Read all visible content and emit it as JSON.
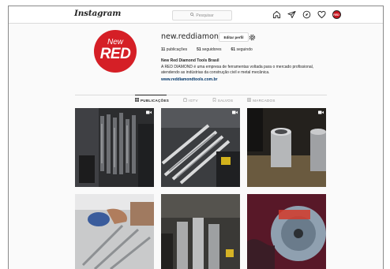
{
  "topbar": {
    "logo": "Instagram",
    "search_placeholder": "Pesquisar",
    "icons": [
      "home-icon",
      "direct-icon",
      "explore-icon",
      "activity-icon",
      "profile-avatar-icon"
    ],
    "avatar_text": "RED"
  },
  "profile": {
    "avatar_new": "New",
    "avatar_red": "RED",
    "username": "new.reddiamond",
    "edit_label": "Editar perfil",
    "stats": [
      {
        "count": "11",
        "label": "publicações"
      },
      {
        "count": "51",
        "label": "seguidores"
      },
      {
        "count": "61",
        "label": "seguindo"
      }
    ],
    "bio_name": "New Red Diamond Tools Brasil",
    "bio_text": "A RED DIAMOND é uma empresa de ferramentas voltada para o mercado profissional, atendendo as indústrias da construção civil e metal mecânica.",
    "bio_link": "www.reddiamondtools.com.br"
  },
  "tabs": [
    {
      "label": "PUBLICAÇÕES",
      "icon": "grid-icon",
      "active": true
    },
    {
      "label": "IGTV",
      "icon": "igtv-icon",
      "active": false
    },
    {
      "label": "SALVOS",
      "icon": "bookmark-icon",
      "active": false
    },
    {
      "label": "MARCADOS",
      "icon": "tagged-icon",
      "active": false
    }
  ],
  "colors": {
    "brand_red": "#d51f26",
    "link": "#003569",
    "border": "#dbdbdb",
    "muted": "#8e8e8e"
  }
}
